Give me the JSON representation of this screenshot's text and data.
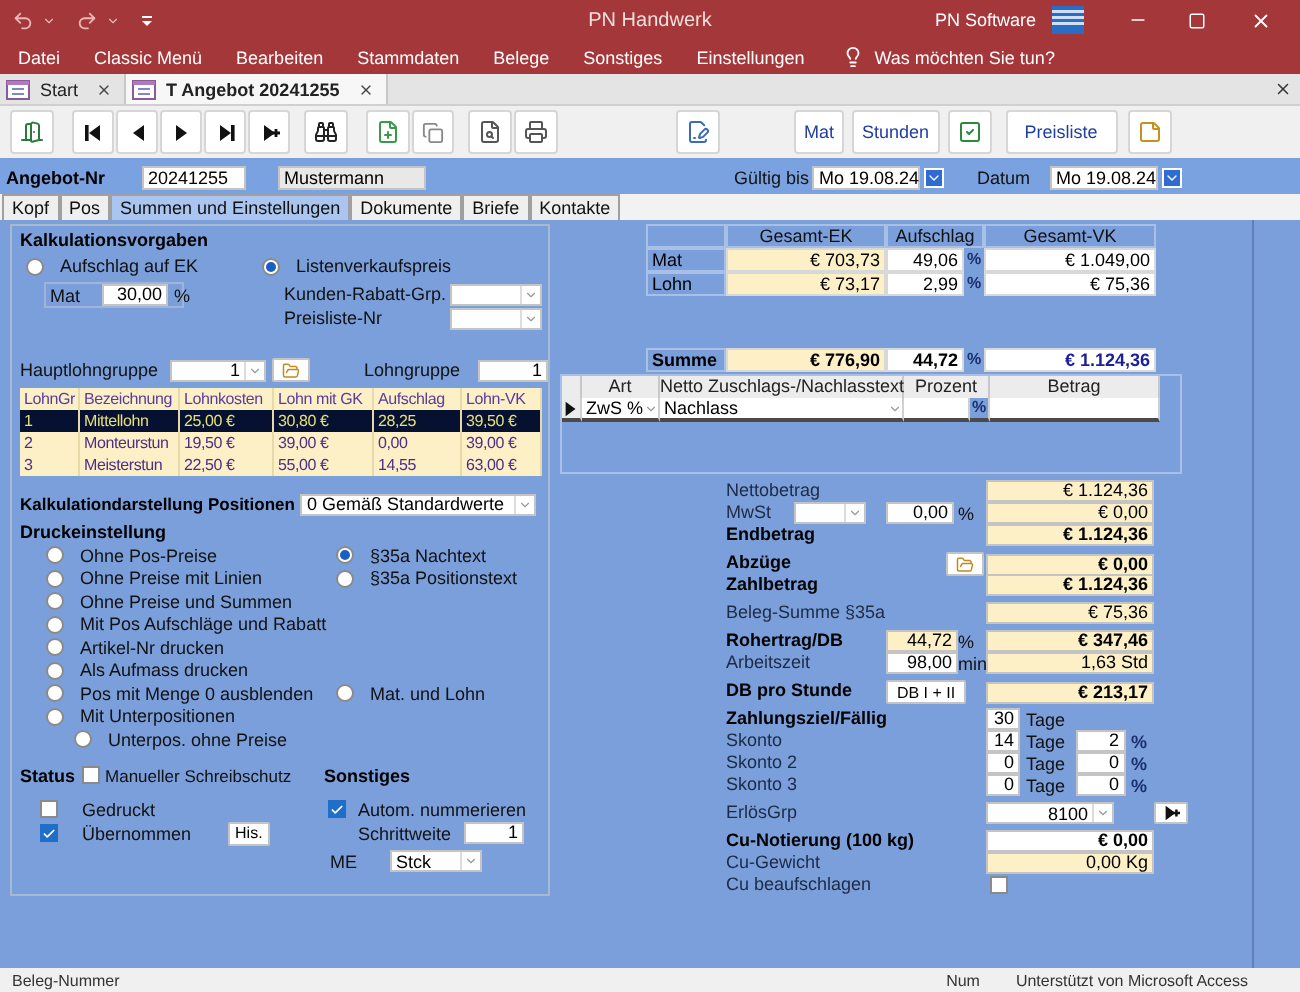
{
  "window": {
    "title": "PN Handwerk",
    "brand": "PN Software"
  },
  "menu": [
    "Datei",
    "Classic Menü",
    "Bearbeiten",
    "Stammdaten",
    "Belege",
    "Sonstiges",
    "Einstellungen"
  ],
  "tell_me": "Was möchten Sie tun?",
  "doc_tabs": [
    {
      "label": "Start",
      "selected": false
    },
    {
      "label": "T Angebot 20241255",
      "selected": true
    }
  ],
  "tool_buttons": [
    {
      "label": "Mat"
    },
    {
      "label": "Stunden"
    },
    {
      "label": "Preisliste"
    }
  ],
  "header": {
    "number_label": "Angebot-Nr",
    "number": "20241255",
    "customer": "Mustermann",
    "valid_label": "Gültig bis",
    "valid": "Mo 19.08.24",
    "date_label": "Datum",
    "date": "Mo 19.08.24"
  },
  "form_tabs": [
    {
      "label": "Kopf",
      "selected": false
    },
    {
      "label": "Pos",
      "selected": false
    },
    {
      "label": "Summen und Einstellungen",
      "selected": true
    },
    {
      "label": "Dokumente",
      "selected": false
    },
    {
      "label": "Briefe",
      "selected": false
    },
    {
      "label": "Kontakte",
      "selected": false
    }
  ],
  "calc": {
    "title": "Kalkulationsvorgaben",
    "methods": [
      {
        "label": "Aufschlag auf EK",
        "selected": false
      },
      {
        "label": "Listenverkaufspreis",
        "selected": true
      }
    ],
    "mat_label": "Mat",
    "mat_value": "30,00",
    "mat_unit": "%",
    "rebate_label": "Kunden-Rabatt-Grp.",
    "pricelist_label": "Preisliste-Nr"
  },
  "wages": {
    "main_label": "Hauptlohngruppe",
    "main_value": "1",
    "group_label": "Lohngruppe",
    "group_value": "1",
    "columns": [
      "LohnGr",
      "Bezeichnung",
      "Lohnkosten",
      "Lohn mit GK",
      "Aufschlag",
      "Lohn-VK"
    ],
    "rows": [
      {
        "cells": [
          "1",
          "Mittellohn",
          "25,00 €",
          "30,80 €",
          "28,25",
          "39,50 €"
        ],
        "selected": true
      },
      {
        "cells": [
          "2",
          "Monteurstun",
          "19,50 €",
          "39,00 €",
          "0,00",
          "39,00 €"
        ],
        "selected": false
      },
      {
        "cells": [
          "3",
          "Meisterstun",
          "22,50 €",
          "55,00 €",
          "14,55",
          "63,00 €"
        ],
        "selected": false
      }
    ]
  },
  "display": {
    "label": "Kalkulationdarstellung Positionen",
    "value": "0 Gemäß Standardwerte"
  },
  "print": {
    "title": "Druckeinstellung",
    "rows": [
      {
        "kind": "option",
        "left": {
          "label": "Ohne Pos-Preise",
          "selected": false
        },
        "right": {
          "label": "§35a Nachtext",
          "selected": true
        }
      },
      {
        "kind": "option",
        "left": {
          "label": "Ohne Preise mit Linien",
          "selected": false
        },
        "right": {
          "label": "§35a Positionstext",
          "selected": false
        }
      },
      {
        "kind": "option",
        "left": {
          "label": "Ohne Preise und Summen",
          "selected": false
        }
      },
      {
        "kind": "option",
        "left": {
          "label": "Mit Pos Aufschläge und Rabatt",
          "selected": false
        }
      },
      {
        "kind": "option",
        "left": {
          "label": "Artikel-Nr drucken",
          "selected": false
        }
      },
      {
        "kind": "option",
        "left": {
          "label": "Als Aufmass drucken",
          "selected": false
        }
      },
      {
        "kind": "option",
        "left": {
          "label": "Pos mit Menge 0 ausblenden",
          "selected": false
        },
        "right": {
          "label": "Mat. und Lohn",
          "selected": false
        }
      },
      {
        "kind": "option",
        "left": {
          "label": "Mit Unterpositionen",
          "selected": false
        }
      },
      {
        "kind": "sub_option",
        "left": {
          "label": "Unterpos. ohne Preise",
          "selected": false
        }
      }
    ]
  },
  "status": {
    "title": "Status",
    "checks": [
      {
        "label": "Manueller Schreibschutz",
        "checked": false
      },
      {
        "label": "Gedruckt",
        "checked": false
      },
      {
        "label": "Übernommen",
        "checked": true
      }
    ],
    "history_button": "His."
  },
  "misc": {
    "title": "Sonstiges",
    "auto_number": {
      "label": "Autom. nummerieren",
      "checked": true
    },
    "step_label": "Schrittweite",
    "step": "1",
    "unit_label": "ME",
    "unit": "Stck"
  },
  "summary": {
    "columns": [
      "Gesamt-EK",
      "Aufschlag",
      "Gesamt-VK"
    ],
    "rows": [
      {
        "label": "Mat",
        "cost": "€ 703,73",
        "markup": "49,06",
        "unit": "%",
        "price": "€ 1.049,00"
      },
      {
        "label": "Lohn",
        "cost": "€ 73,17",
        "markup": "2,99",
        "unit": "%",
        "price": "€ 75,36"
      }
    ],
    "total": {
      "label": "Summe",
      "cost": "€ 776,90",
      "markup": "44,72",
      "unit": "%",
      "price": "€ 1.124,36"
    }
  },
  "adjustments": {
    "columns": [
      "Art",
      "Netto Zuschlags-/Nachlasstext",
      "Prozent",
      "Betrag"
    ],
    "rows": [
      {
        "type": "ZwS %",
        "text": "Nachlass",
        "unit": "%"
      }
    ]
  },
  "totals": [
    {
      "rows": [
        {
          "kind": "amount",
          "label": "Nettobetrag",
          "value": "€ 1.124,36",
          "strong": false
        },
        {
          "kind": "tax",
          "label": "MwSt",
          "rate": "0,00",
          "unit": "%",
          "value": "€ 0,00",
          "strong": false
        },
        {
          "kind": "amount",
          "label": "Endbetrag",
          "value": "€ 1.124,36",
          "strong": true
        }
      ]
    },
    {
      "rows": [
        {
          "kind": "action",
          "label": "Abzüge",
          "value": "€ 0,00",
          "strong": true
        },
        {
          "kind": "amount",
          "label": "Zahlbetrag",
          "value": "€ 1.124,36",
          "strong": true
        }
      ]
    },
    {
      "rows": [
        {
          "kind": "amount",
          "label": "Beleg-Summe §35a",
          "value": "€ 75,36",
          "strong": false
        }
      ]
    },
    {
      "rows": [
        {
          "kind": "ratio",
          "label": "Rohertrag/DB",
          "input": "44,72",
          "editable": false,
          "unit": "%",
          "value": "€ 347,46",
          "strong": true
        },
        {
          "kind": "ratio",
          "label": "Arbeitszeit",
          "input": "98,00",
          "editable": true,
          "unit": "min",
          "value": "1,63 Std",
          "strong": false
        }
      ]
    },
    {
      "rows": [
        {
          "kind": "button",
          "label": "DB pro Stunde",
          "button": "DB I + II",
          "value": "€ 213,17",
          "strong": true
        }
      ]
    },
    {
      "rows": [
        {
          "kind": "terms",
          "label": "Zahlungsziel/Fällig",
          "days": "30",
          "days_unit": "Tage",
          "strong": true
        },
        {
          "kind": "terms",
          "label": "Skonto",
          "days": "14",
          "days_unit": "Tage",
          "percent": "2",
          "percent_unit": "%",
          "strong": false
        },
        {
          "kind": "terms",
          "label": "Skonto 2",
          "days": "0",
          "days_unit": "Tage",
          "percent": "0",
          "percent_unit": "%",
          "strong": false
        },
        {
          "kind": "terms",
          "label": "Skonto 3",
          "days": "0",
          "days_unit": "Tage",
          "percent": "0",
          "percent_unit": "%",
          "strong": false
        }
      ]
    },
    {
      "rows": [
        {
          "kind": "select",
          "label": "ErlösGrp",
          "value": "8100",
          "strong": false
        }
      ]
    },
    {
      "rows": [
        {
          "kind": "field",
          "label": "Cu-Notierung (100 kg)",
          "value": "€ 0,00",
          "editable": true,
          "strong": true
        },
        {
          "kind": "field",
          "label": "Cu-Gewicht",
          "value": "0,00 Kg",
          "editable": false,
          "strong": false
        },
        {
          "kind": "check",
          "label": "Cu beaufschlagen",
          "checked": false,
          "strong": false
        }
      ]
    }
  ],
  "status_bar": {
    "field": "Beleg-Nummer",
    "mode": "Num",
    "info": "Unterstützt von Microsoft Access"
  }
}
